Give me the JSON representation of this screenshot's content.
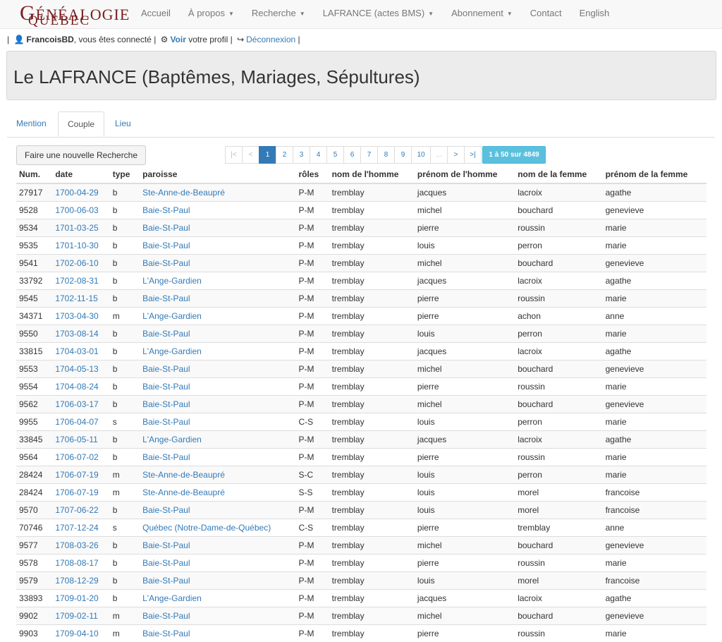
{
  "brand": {
    "line1": "Généalogie",
    "line2": "Québec"
  },
  "nav": [
    {
      "label": "Accueil",
      "caret": false
    },
    {
      "label": "À propos",
      "caret": true
    },
    {
      "label": "Recherche",
      "caret": true
    },
    {
      "label": "LAFRANCE (actes BMS)",
      "caret": true
    },
    {
      "label": "Abonnement",
      "caret": true
    },
    {
      "label": "Contact",
      "caret": false
    },
    {
      "label": "English",
      "caret": false
    }
  ],
  "userbar": {
    "username": "FrancoisBD",
    "connected_text": ", vous êtes connecté",
    "voir": "Voir",
    "profile_text": " votre profil",
    "logout": "Déconnexion"
  },
  "page_title": "Le LAFRANCE (Baptêmes, Mariages, Sépultures)",
  "tabs": [
    "Mention",
    "Couple",
    "Lieu"
  ],
  "active_tab": 1,
  "new_search_label": "Faire une nouvelle Recherche",
  "pagination": {
    "pages": [
      "|<",
      "<",
      "1",
      "2",
      "3",
      "4",
      "5",
      "6",
      "7",
      "8",
      "9",
      "10",
      "...",
      ">",
      ">|"
    ],
    "current": "1",
    "info": "1 à 50 sur 4849"
  },
  "table": {
    "columns": [
      "Num.",
      "date",
      "type",
      "paroisse",
      "rôles",
      "nom de l'homme",
      "prénom de l'homme",
      "nom de la femme",
      "prénom de la femme"
    ],
    "rows": [
      [
        "27917",
        "1700-04-29",
        "b",
        "Ste-Anne-de-Beaupré",
        "P-M",
        "tremblay",
        "jacques",
        "lacroix",
        "agathe"
      ],
      [
        "9528",
        "1700-06-03",
        "b",
        "Baie-St-Paul",
        "P-M",
        "tremblay",
        "michel",
        "bouchard",
        "genevieve"
      ],
      [
        "9534",
        "1701-03-25",
        "b",
        "Baie-St-Paul",
        "P-M",
        "tremblay",
        "pierre",
        "roussin",
        "marie"
      ],
      [
        "9535",
        "1701-10-30",
        "b",
        "Baie-St-Paul",
        "P-M",
        "tremblay",
        "louis",
        "perron",
        "marie"
      ],
      [
        "9541",
        "1702-06-10",
        "b",
        "Baie-St-Paul",
        "P-M",
        "tremblay",
        "michel",
        "bouchard",
        "genevieve"
      ],
      [
        "33792",
        "1702-08-31",
        "b",
        "L'Ange-Gardien",
        "P-M",
        "tremblay",
        "jacques",
        "lacroix",
        "agathe"
      ],
      [
        "9545",
        "1702-11-15",
        "b",
        "Baie-St-Paul",
        "P-M",
        "tremblay",
        "pierre",
        "roussin",
        "marie"
      ],
      [
        "34371",
        "1703-04-30",
        "m",
        "L'Ange-Gardien",
        "P-M",
        "tremblay",
        "pierre",
        "achon",
        "anne"
      ],
      [
        "9550",
        "1703-08-14",
        "b",
        "Baie-St-Paul",
        "P-M",
        "tremblay",
        "louis",
        "perron",
        "marie"
      ],
      [
        "33815",
        "1704-03-01",
        "b",
        "L'Ange-Gardien",
        "P-M",
        "tremblay",
        "jacques",
        "lacroix",
        "agathe"
      ],
      [
        "9553",
        "1704-05-13",
        "b",
        "Baie-St-Paul",
        "P-M",
        "tremblay",
        "michel",
        "bouchard",
        "genevieve"
      ],
      [
        "9554",
        "1704-08-24",
        "b",
        "Baie-St-Paul",
        "P-M",
        "tremblay",
        "pierre",
        "roussin",
        "marie"
      ],
      [
        "9562",
        "1706-03-17",
        "b",
        "Baie-St-Paul",
        "P-M",
        "tremblay",
        "michel",
        "bouchard",
        "genevieve"
      ],
      [
        "9955",
        "1706-04-07",
        "s",
        "Baie-St-Paul",
        "C-S",
        "tremblay",
        "louis",
        "perron",
        "marie"
      ],
      [
        "33845",
        "1706-05-11",
        "b",
        "L'Ange-Gardien",
        "P-M",
        "tremblay",
        "jacques",
        "lacroix",
        "agathe"
      ],
      [
        "9564",
        "1706-07-02",
        "b",
        "Baie-St-Paul",
        "P-M",
        "tremblay",
        "pierre",
        "roussin",
        "marie"
      ],
      [
        "28424",
        "1706-07-19",
        "m",
        "Ste-Anne-de-Beaupré",
        "S-C",
        "tremblay",
        "louis",
        "perron",
        "marie"
      ],
      [
        "28424",
        "1706-07-19",
        "m",
        "Ste-Anne-de-Beaupré",
        "S-S",
        "tremblay",
        "louis",
        "morel",
        "francoise"
      ],
      [
        "9570",
        "1707-06-22",
        "b",
        "Baie-St-Paul",
        "P-M",
        "tremblay",
        "louis",
        "morel",
        "francoise"
      ],
      [
        "70746",
        "1707-12-24",
        "s",
        "Québec (Notre-Dame-de-Québec)",
        "C-S",
        "tremblay",
        "pierre",
        "tremblay",
        "anne"
      ],
      [
        "9577",
        "1708-03-26",
        "b",
        "Baie-St-Paul",
        "P-M",
        "tremblay",
        "michel",
        "bouchard",
        "genevieve"
      ],
      [
        "9578",
        "1708-08-17",
        "b",
        "Baie-St-Paul",
        "P-M",
        "tremblay",
        "pierre",
        "roussin",
        "marie"
      ],
      [
        "9579",
        "1708-12-29",
        "b",
        "Baie-St-Paul",
        "P-M",
        "tremblay",
        "louis",
        "morel",
        "francoise"
      ],
      [
        "33893",
        "1709-01-20",
        "b",
        "L'Ange-Gardien",
        "P-M",
        "tremblay",
        "jacques",
        "lacroix",
        "agathe"
      ],
      [
        "9902",
        "1709-02-11",
        "m",
        "Baie-St-Paul",
        "P-M",
        "tremblay",
        "michel",
        "bouchard",
        "genevieve"
      ],
      [
        "9903",
        "1709-04-10",
        "m",
        "Baie-St-Paul",
        "P-M",
        "tremblay",
        "pierre",
        "roussin",
        "marie"
      ]
    ]
  }
}
